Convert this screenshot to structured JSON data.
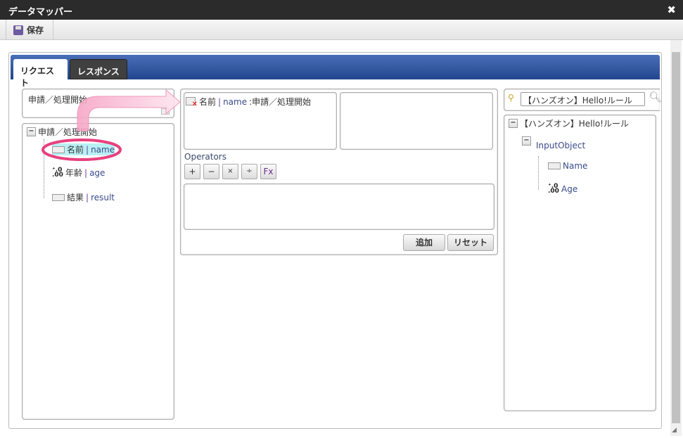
{
  "window": {
    "title": "データマッパー",
    "close_icon": "close-icon"
  },
  "toolbar": {
    "save_label": "保存",
    "save_icon": "floppy-disk-icon"
  },
  "tabs": [
    {
      "label": "リクエスト",
      "active": true
    },
    {
      "label": "レスポンス",
      "active": false
    }
  ],
  "left": {
    "selector_value": "申請／処理開始",
    "tree": {
      "root": "申請／処理開始",
      "items": [
        {
          "name": "名前",
          "key": "name",
          "type": "string",
          "highlighted": true
        },
        {
          "name": "年齢",
          "key": "age",
          "type": "number"
        },
        {
          "name": "結果",
          "key": "result",
          "type": "string"
        }
      ]
    }
  },
  "middle": {
    "source": {
      "name": "名前",
      "key": "name",
      "context": ":申請／処理開始"
    },
    "operators_label": "Operators",
    "operators": [
      "+",
      "−",
      "×",
      "÷",
      "Fx"
    ],
    "add_label": "追加",
    "reset_label": "リセット"
  },
  "right": {
    "search_value": "【ハンズオン】Hello!ルール",
    "tree": {
      "root": "【ハンズオン】Hello!ルール",
      "object": "InputObject",
      "items": [
        {
          "name": "Name",
          "type": "string"
        },
        {
          "name": "Age",
          "type": "number"
        }
      ]
    }
  },
  "annotation_color": "#e8417e"
}
